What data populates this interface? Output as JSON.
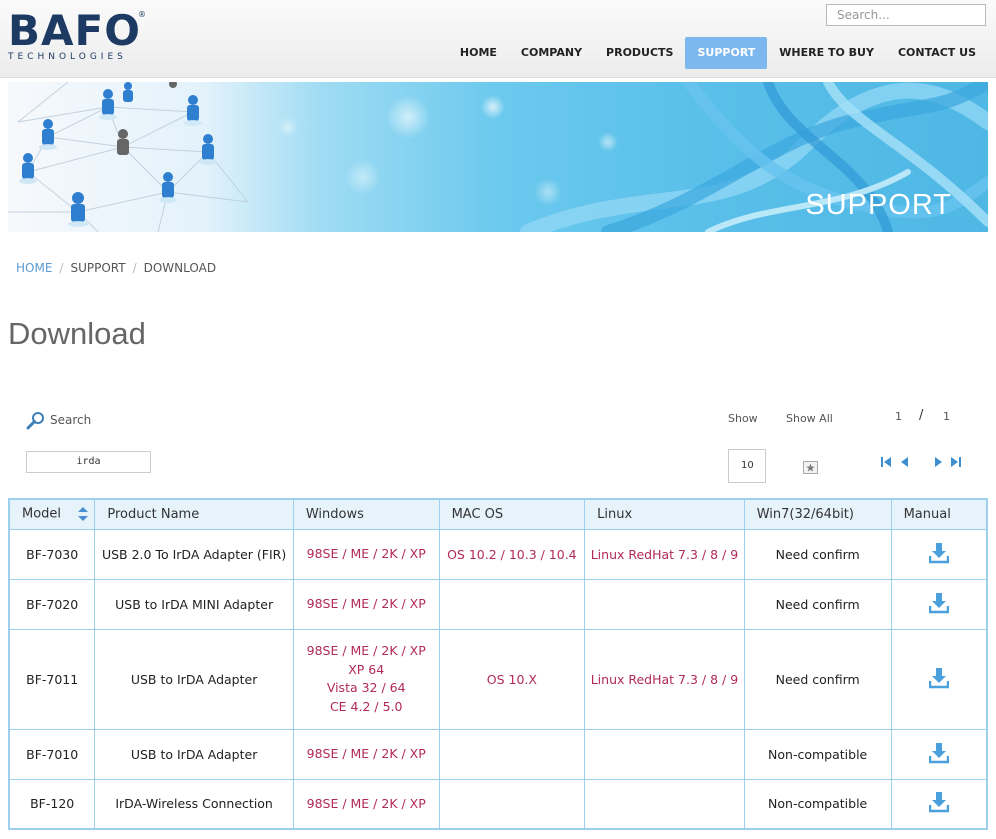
{
  "header": {
    "logo_text": "BAFO",
    "logo_sub": "TECHNOLOGIES",
    "logo_reg": "®",
    "search_placeholder": "Search...",
    "nav": [
      {
        "label": "HOME",
        "active": false
      },
      {
        "label": "COMPANY",
        "active": false
      },
      {
        "label": "PRODUCTS",
        "active": false
      },
      {
        "label": "SUPPORT",
        "active": true
      },
      {
        "label": "WHERE TO BUY",
        "active": false
      },
      {
        "label": "CONTACT US",
        "active": false
      }
    ]
  },
  "banner": {
    "title": "SUPPORT"
  },
  "breadcrumb": {
    "home": "HOME",
    "support": "SUPPORT",
    "current": "DOWNLOAD",
    "separator": "/"
  },
  "page_title": "Download",
  "controls": {
    "search_label": "Search",
    "search_value": "irda",
    "show_label": "Show",
    "show_value": "10",
    "show_all_label": "Show All",
    "page_current": "1",
    "page_separator": "/",
    "page_total": "1"
  },
  "table": {
    "headers": {
      "model": "Model",
      "product": "Product Name",
      "windows": "Windows",
      "mac": "MAC OS",
      "linux": "Linux",
      "win7": "Win7(32/64bit)",
      "manual": "Manual"
    },
    "rows": [
      {
        "model": "BF-7030",
        "product": "USB 2.0 To IrDA Adapter (FIR)",
        "windows": [
          "98SE / ME / 2K / XP"
        ],
        "mac": "OS 10.2 / 10.3 / 10.4",
        "linux": "Linux RedHat 7.3 / 8 / 9",
        "win7": "Need confirm"
      },
      {
        "model": "BF-7020",
        "product": "USB to IrDA MINI Adapter",
        "windows": [
          "98SE / ME / 2K / XP"
        ],
        "mac": "",
        "linux": "",
        "win7": "Need confirm"
      },
      {
        "model": "BF-7011",
        "product": "USB to IrDA Adapter",
        "windows": [
          "98SE / ME / 2K / XP",
          "XP 64",
          "Vista 32 / 64",
          "CE 4.2 / 5.0"
        ],
        "mac": "OS 10.X",
        "linux": "Linux RedHat 7.3 / 8 / 9",
        "win7": "Need confirm"
      },
      {
        "model": "BF-7010",
        "product": "USB to IrDA Adapter",
        "windows": [
          "98SE / ME / 2K / XP"
        ],
        "mac": "",
        "linux": "",
        "win7": "Non-compatible"
      },
      {
        "model": "BF-120",
        "product": "IrDA-Wireless Connection",
        "windows": [
          "98SE / ME / 2K / XP"
        ],
        "mac": "",
        "linux": "",
        "win7": "Non-compatible"
      }
    ]
  },
  "icons": {
    "download": "download-icon",
    "search": "magnifier-icon",
    "sort": "sort-icon",
    "show_all": "star-box-icon",
    "pager": [
      "first-page-icon",
      "prev-page-icon",
      "next-page-icon",
      "last-page-icon"
    ]
  },
  "colors": {
    "brand": "#1d3a63",
    "nav_active": "#7cb7ee",
    "os_text": "#b22a55",
    "table_border": "#9dd0ee",
    "table_header_bg": "#e6f3fb",
    "link": "#5a9bd5",
    "icon_blue": "#3e8ed0"
  }
}
